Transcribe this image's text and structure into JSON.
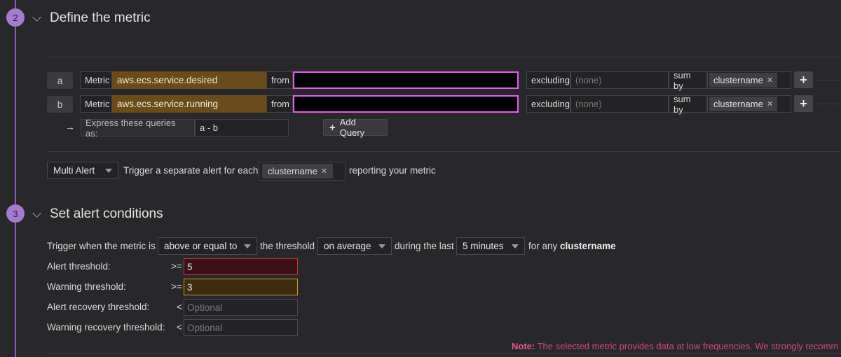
{
  "step2": {
    "number": "2",
    "title": "Define the metric"
  },
  "queries": [
    {
      "label": "a",
      "metric_label": "Metric",
      "metric_value": "aws.ecs.service.desired",
      "from_label": "from",
      "excluding_label": "excluding",
      "excluding_placeholder": "(none)",
      "sumby_label": "sum by",
      "sumby_tag": "clustername"
    },
    {
      "label": "b",
      "metric_label": "Metric",
      "metric_value": "aws.ecs.service.running",
      "from_label": "from",
      "excluding_label": "excluding",
      "excluding_placeholder": "(none)",
      "sumby_label": "sum by",
      "sumby_tag": "clustername"
    }
  ],
  "formula": {
    "arrow": "→",
    "label": "Express these queries as:",
    "value": "a - b",
    "add_query_label": "Add Query"
  },
  "multi_alert": {
    "select_value": "Multi Alert",
    "prefix": "Trigger a separate alert for each",
    "tag": "clustername",
    "suffix": "reporting your metric"
  },
  "step3": {
    "number": "3",
    "title": "Set alert conditions"
  },
  "conditions": {
    "trigger_prefix": "Trigger when the metric is",
    "comparison": "above or equal to",
    "threshold_text": "the threshold",
    "aggregation": "on average",
    "during_text": "during the last",
    "window": "5 minutes",
    "for_any_text": "for any",
    "for_any_group": "clustername"
  },
  "thresholds": [
    {
      "label": "Alert threshold:",
      "operator": ">=",
      "value": "5",
      "placeholder": ""
    },
    {
      "label": "Warning threshold:",
      "operator": ">=",
      "value": "3",
      "placeholder": ""
    },
    {
      "label": "Alert recovery threshold:",
      "operator": "<",
      "value": "",
      "placeholder": "Optional"
    },
    {
      "label": "Warning recovery threshold:",
      "operator": "<",
      "value": "",
      "placeholder": "Optional"
    }
  ],
  "note": {
    "label": "Note:",
    "text": "The selected metric provides data at low frequencies. We strongly recomm"
  },
  "icons": {
    "plus": "plus-icon",
    "remove": "close-icon",
    "dropdown": "chevron-down-icon"
  },
  "colors": {
    "accent": "#a57bcf",
    "from_border": "#e65ef0",
    "alert": "#b83a47",
    "warning": "#c89a3a",
    "note": "#d44a7a"
  }
}
